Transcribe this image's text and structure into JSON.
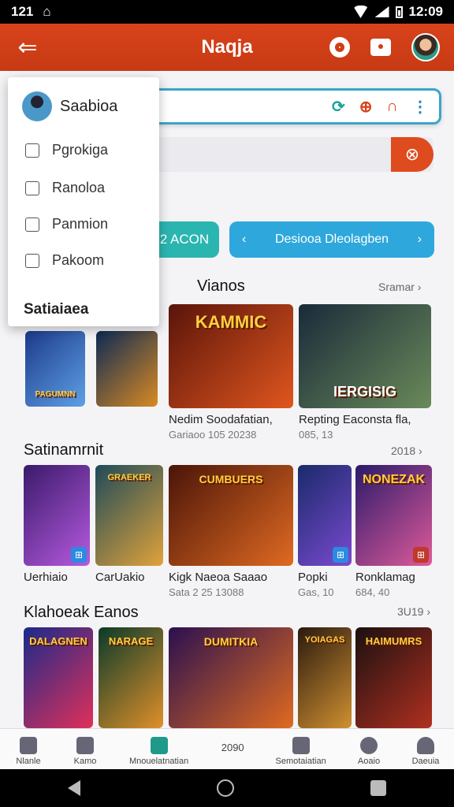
{
  "status": {
    "time": "121",
    "time_right": "12:09"
  },
  "appbar": {
    "title": "Naqja"
  },
  "drawer": {
    "user": "Saabioa",
    "items": [
      {
        "label": "Pgrokiga"
      },
      {
        "label": "Ranoloa"
      },
      {
        "label": "Panmion"
      },
      {
        "label": "Pakoom"
      }
    ],
    "footer": "Satiaiaea"
  },
  "buttons": {
    "teal": "2 ACON",
    "blue": "Desiooa Dleolagben"
  },
  "sections": [
    {
      "title": "Vianos",
      "more": "Sramar",
      "cards": [
        {
          "art": "PAGUMNN",
          "color1": "#1c3a8a",
          "color2": "#5fa0e6"
        },
        {
          "art": "",
          "color1": "#0d2a55",
          "color2": "#d98a22"
        },
        {
          "art": "KAMMIC",
          "color1": "#5a140a",
          "color2": "#e0561e",
          "caption": "Nedim Soodafatian,",
          "sub": "Gariaoo 105 20238"
        },
        {
          "art": "IERGISIG",
          "color1": "#1a2a3a",
          "color2": "#6a8a5a",
          "caption": "Repting Eaconsta fla,",
          "sub": "085, 13"
        }
      ]
    },
    {
      "title": "Satinamrnit",
      "more": "2018",
      "cards": [
        {
          "art": "",
          "color1": "#3a1a6a",
          "color2": "#b65ae0",
          "caption": "Uerhiaio"
        },
        {
          "art": "GRAEKER",
          "color1": "#1e4a5a",
          "color2": "#e0a23a",
          "caption": "CarUakio"
        },
        {
          "art": "CUMBUERS",
          "color1": "#4a1408",
          "color2": "#e06a22",
          "caption": "Kigk Naeoa Saaao",
          "sub": "Sata 2 25 13088"
        },
        {
          "art": "",
          "color1": "#1a2a6a",
          "color2": "#7a4ad0",
          "caption": "Popki",
          "sub": "Gas, 10"
        },
        {
          "art": "NONEZAK",
          "color1": "#2a1a6a",
          "color2": "#e05a9a",
          "caption": "Ronklamag",
          "sub": "684, 40"
        }
      ]
    },
    {
      "title": "Klahoeak Eanos",
      "more": "3U19",
      "cards": [
        {
          "art": "DALAGNEN",
          "color1": "#1a2a8a",
          "color2": "#e0305a"
        },
        {
          "art": "NARAGE",
          "color1": "#0a3a2a",
          "color2": "#e0902a"
        },
        {
          "art": "DUMITKIA",
          "color1": "#2a1050",
          "color2": "#e06a20"
        },
        {
          "art": "YOIAGAS",
          "color1": "#2a1a10",
          "color2": "#d09030"
        },
        {
          "art": "HAIMUMRS",
          "color1": "#1a1010",
          "color2": "#b03020"
        }
      ]
    }
  ],
  "bottomnav": [
    {
      "label": "Nlanle"
    },
    {
      "label": "Kamo"
    },
    {
      "label": "Mnouelatnatian"
    },
    {
      "label": "2090"
    },
    {
      "label": "Semotaiatian"
    },
    {
      "label": "Aoaio"
    },
    {
      "label": "Daeuia"
    }
  ]
}
